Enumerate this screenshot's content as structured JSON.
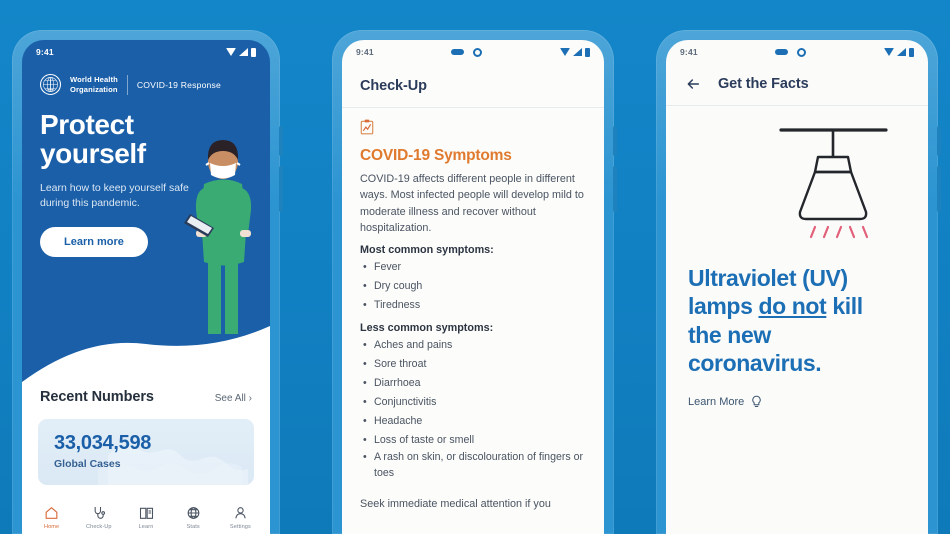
{
  "background_color": "#1386c9",
  "phone_frame_color": "#2b94d1",
  "phone1": {
    "status_bar": {
      "time": "9:41",
      "wifi_icon": "wifi-icon",
      "cellular_icon": "cellular-signal-icon",
      "battery_icon": "battery-icon"
    },
    "brand": {
      "logo_icon": "who-logo-icon",
      "name_line1": "World Health",
      "name_line2": "Organization",
      "subtitle": "COVID-19 Response"
    },
    "hero": {
      "title_line1": "Protect",
      "title_line2": "yourself",
      "subtitle": "Learn how to keep yourself safe during this pandemic.",
      "cta_label": "Learn more",
      "illustration": "healthcare-worker-illustration",
      "background_color": "#1a5fa8"
    },
    "recent_numbers": {
      "heading": "Recent Numbers",
      "see_all_label": "See All ›",
      "stat_value": "33,034,598",
      "stat_label": "Global Cases",
      "stat_value_color": "#1a5fa8"
    },
    "tabbar": [
      {
        "label": "Home",
        "icon": "home-icon",
        "active": true
      },
      {
        "label": "Check-Up",
        "icon": "stethoscope-icon",
        "active": false
      },
      {
        "label": "Learn",
        "icon": "book-icon",
        "active": false
      },
      {
        "label": "Stats",
        "icon": "globe-icon",
        "active": false
      },
      {
        "label": "Settings",
        "icon": "person-icon",
        "active": false
      }
    ],
    "active_tab_color": "#d96a3a"
  },
  "phone2": {
    "status_bar": {
      "time": "9:41",
      "pill_icon": "capsule-icon",
      "ring_icon": "ring-icon",
      "wifi_icon": "wifi-icon",
      "cellular_icon": "cellular-signal-icon",
      "battery_icon": "battery-icon"
    },
    "appbar_title": "Check-Up",
    "card_icon": "clipboard-chart-icon",
    "section_title": "COVID-19 Symptoms",
    "section_title_color": "#e07a2e",
    "intro": "COVID-19 affects different people in different ways. Most infected people will develop mild to moderate illness and recover without hospitalization.",
    "most_common_heading": "Most common symptoms:",
    "most_common": [
      "Fever",
      "Dry cough",
      "Tiredness"
    ],
    "less_common_heading": "Less common symptoms:",
    "less_common": [
      "Aches and pains",
      "Sore throat",
      "Diarrhoea",
      "Conjunctivitis",
      "Headache",
      "Loss of taste or smell",
      "A rash on skin, or discolouration of fingers or toes"
    ],
    "footer_text": "Seek immediate medical attention if you"
  },
  "phone3": {
    "status_bar": {
      "time": "9:41",
      "pill_icon": "capsule-icon",
      "ring_icon": "ring-icon",
      "wifi_icon": "wifi-icon",
      "cellular_icon": "cellular-signal-icon",
      "battery_icon": "battery-icon"
    },
    "back_icon": "back-arrow-icon",
    "appbar_title": "Get the Facts",
    "illustration": "uv-lamp-illustration",
    "fact_line1": "Ultraviolet (UV)",
    "fact_line2_a": "lamps ",
    "fact_line2_b": "do not",
    "fact_line2_c": " kill",
    "fact_line3": "the new",
    "fact_line4": "coronavirus.",
    "fact_color": "#1c6fb5",
    "learn_more_label": "Learn More",
    "learn_more_icon": "lightbulb-icon"
  }
}
